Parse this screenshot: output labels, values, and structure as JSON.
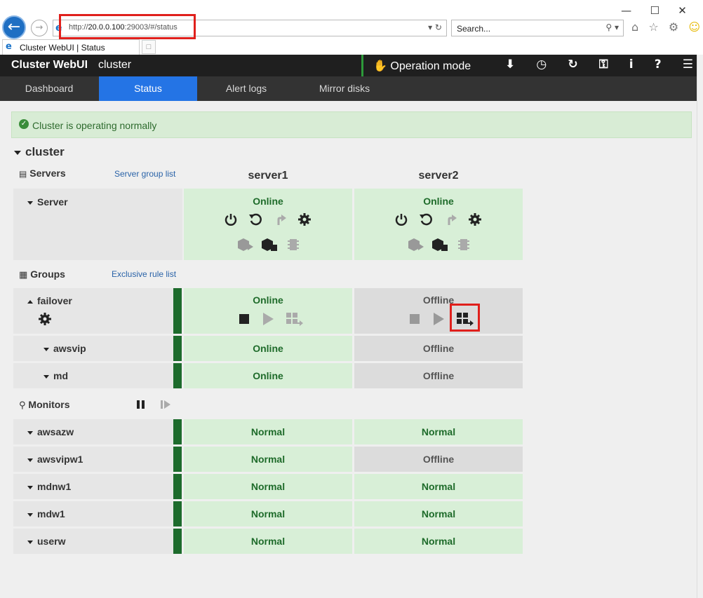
{
  "browser": {
    "url_prefix": "http://",
    "url_host": "20.0.0.100",
    "url_rest": ":29003/#/status",
    "search_placeholder": "Search...",
    "tab_title": "Cluster WebUI | Status"
  },
  "header": {
    "app_title": "Cluster WebUI",
    "cluster_name": "cluster",
    "operation_mode": "Operation mode"
  },
  "nav": {
    "tabs": [
      "Dashboard",
      "Status",
      "Alert logs",
      "Mirror disks"
    ],
    "active": "Status"
  },
  "alert": {
    "message": "Cluster is operating normally"
  },
  "cluster": {
    "name": "cluster",
    "servers_title": "Servers",
    "server_group_link": "Server group list",
    "server_row_label": "Server",
    "servers": [
      {
        "name": "server1",
        "status": "Online"
      },
      {
        "name": "server2",
        "status": "Online"
      }
    ],
    "groups_title": "Groups",
    "exclusive_rule_link": "Exclusive rule list",
    "groups": [
      {
        "name": "failover",
        "statuses": [
          "Online",
          "Offline"
        ]
      },
      {
        "name": "awsvip",
        "statuses": [
          "Online",
          "Offline"
        ]
      },
      {
        "name": "md",
        "statuses": [
          "Online",
          "Offline"
        ]
      }
    ],
    "monitors_title": "Monitors",
    "monitors": [
      {
        "name": "awsazw",
        "statuses": [
          "Normal",
          "Normal"
        ]
      },
      {
        "name": "awsvipw1",
        "statuses": [
          "Normal",
          "Offline"
        ]
      },
      {
        "name": "mdnw1",
        "statuses": [
          "Normal",
          "Normal"
        ]
      },
      {
        "name": "mdw1",
        "statuses": [
          "Normal",
          "Normal"
        ]
      },
      {
        "name": "userw",
        "statuses": [
          "Normal",
          "Normal"
        ]
      }
    ]
  },
  "colors": {
    "online": "#1e6b2a",
    "offline_text": "#555555",
    "online_bg": "#d8efd7",
    "offline_bg": "#dcdcdc",
    "accent_tab": "#2474e5",
    "group_bar": "#1d6b2c",
    "highlight": "#e0201c"
  }
}
